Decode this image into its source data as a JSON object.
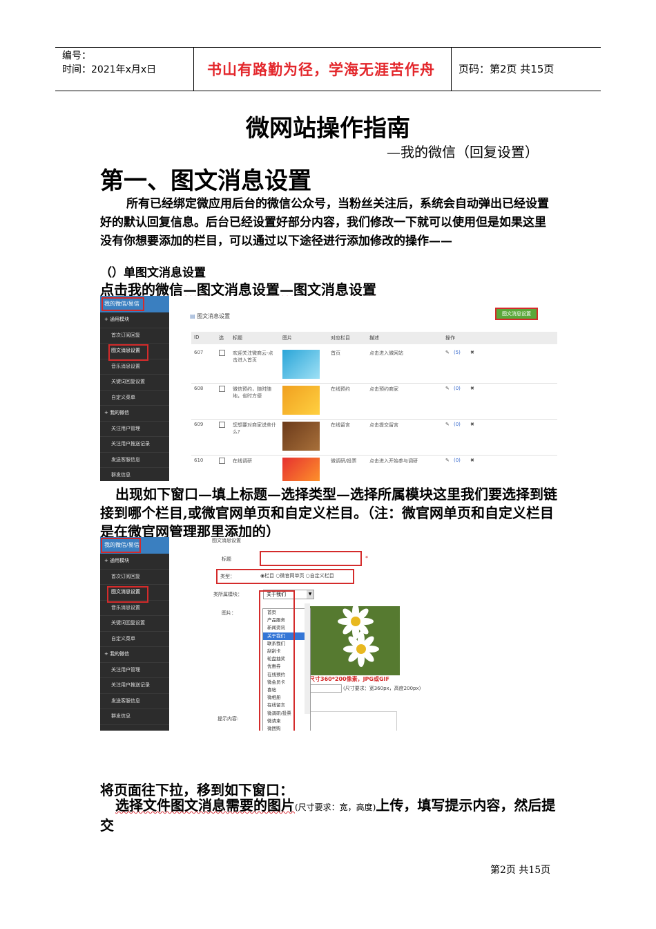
{
  "header": {
    "number_label": "编号：",
    "time_label": "时间：2021年x月x日",
    "motto": "书山有路勤为径，学海无涯苦作舟",
    "page_label": "页码：第2页 共15页"
  },
  "title": "微网站操作指南",
  "subtitle": "—我的微信（回复设置）",
  "section_heading": "第一、图文消息设置",
  "intro_paragraph": "所有已经绑定微应用后台的微信公众号，当粉丝关注后，系统会自动弹出已经设置好的默认回复信息。后台已经设置好部分内容，我们修改一下就可以使用但是如果这里没有你想要添加的栏目，可以通过以下途径进行添加修改的操作——",
  "sub_heading": "（）单图文消息设置",
  "nav_path": "点击我的微信—图文消息设置—图文消息设置",
  "screenshot1": {
    "sidebar_title": "我的微信/易信",
    "sidebar": [
      {
        "type": "grp",
        "label": "+ 通用模块"
      },
      {
        "type": "item",
        "label": "首次订阅回复"
      },
      {
        "type": "item",
        "label": "图文消息设置"
      },
      {
        "type": "item",
        "label": "音乐消息设置"
      },
      {
        "type": "item",
        "label": "关键词回复设置"
      },
      {
        "type": "item",
        "label": "自定义菜单"
      },
      {
        "type": "grp",
        "label": "+ 我的微信"
      },
      {
        "type": "item",
        "label": "关注用户管理"
      },
      {
        "type": "item",
        "label": "关注用户推送记录"
      },
      {
        "type": "item",
        "label": "发送客服信息"
      },
      {
        "type": "item",
        "label": "群发信息"
      }
    ],
    "page_title": "图文消息设置",
    "button": "图文消息设置",
    "columns": [
      "ID",
      "选",
      "标题",
      "图片",
      "对应栏目",
      "描述",
      "操作"
    ],
    "rows": [
      {
        "id": "607",
        "title": "欢迎关注微商云-点击进入首页",
        "col": "首页",
        "desc": "点击进入微网站",
        "ops": "(5)"
      },
      {
        "id": "608",
        "title": "微信预约，随时随地，省时方便",
        "col": "在线预约",
        "desc": "点击预约商家",
        "ops": "(0)"
      },
      {
        "id": "609",
        "title": "您想要对商家说些什么?",
        "col": "在线留言",
        "desc": "点击提交留言",
        "ops": "(0)"
      },
      {
        "id": "610",
        "title": "在线调研",
        "col": "微调研/投票",
        "desc": "点击进入开始参与调研",
        "ops": "(0)"
      }
    ]
  },
  "paragraph2": "出现如下窗口—填上标题—选择类型—选择所属模块这里我们要选择到链接到哪个栏目,或微官网单页和自定义栏目。（注：微官网单页和自定义栏目是在微官网管理那里添加的）",
  "screenshot2": {
    "sidebar_title": "我的微信/易信",
    "sidebar": [
      {
        "type": "grp",
        "label": "+ 通用模块"
      },
      {
        "type": "item",
        "label": "首次订阅回复"
      },
      {
        "type": "item",
        "label": "图文消息设置"
      },
      {
        "type": "item",
        "label": "音乐消息设置"
      },
      {
        "type": "item",
        "label": "关键词回复设置"
      },
      {
        "type": "item",
        "label": "自定义菜单"
      },
      {
        "type": "grp",
        "label": "+ 我的微信"
      },
      {
        "type": "item",
        "label": "关注用户管理"
      },
      {
        "type": "item",
        "label": "关注用户推送记录"
      },
      {
        "type": "item",
        "label": "发送客服信息"
      },
      {
        "type": "item",
        "label": "群发信息"
      }
    ],
    "form_title": "图文消息设置",
    "label_title": "标题",
    "label_type": "类型：",
    "type_options": "◉栏目 ○微官网单页 ○自定义栏目",
    "label_module": "类所属模块：",
    "module_value": "关于我们",
    "label_image": "图片：",
    "label_hint": "提示内容:",
    "size_note": "尺寸360*200像素，JPG或GIF",
    "size_req": "(尺寸要求：宽360px，高度200px)",
    "dropdown": [
      "首页",
      "产品服务",
      "新闻资讯",
      "关于我们",
      "联系我们",
      "刮刮卡",
      "轮盘抽奖",
      "优惠券",
      "在线预约",
      "微会员卡",
      "喜帖",
      "微相册",
      "在线留言",
      "微调研/投票",
      "微请柬",
      "微团购",
      "酒店预订"
    ],
    "dropdown_selected": "关于我们"
  },
  "paragraph3": "将页面往下拉，移到如下窗口：",
  "paragraph4_a": "选择文件图文消息需要的图片",
  "paragraph4_small": "(尺寸要求：宽，高度)",
  "paragraph4_b": "上传，填写提示内容，然后提交",
  "footer": "第2页 共15页"
}
